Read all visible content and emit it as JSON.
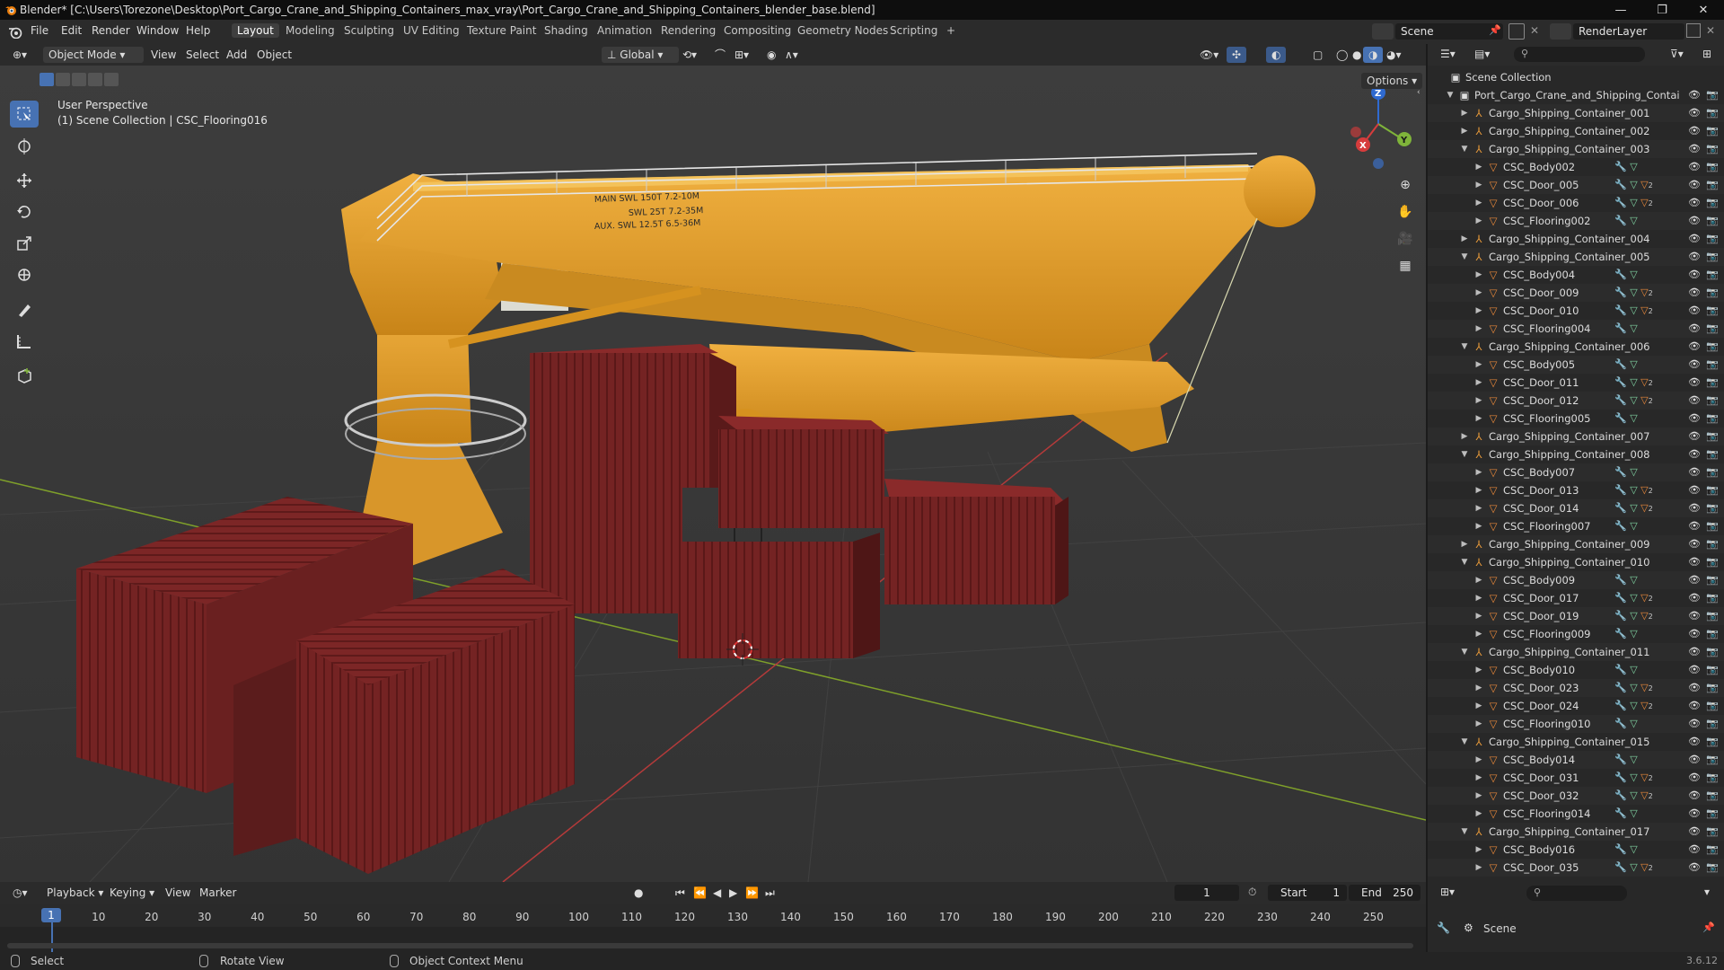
{
  "window": {
    "title": "Blender* [C:\\Users\\Torezone\\Desktop\\Port_Cargo_Crane_and_Shipping_Containers_max_vray\\Port_Cargo_Crane_and_Shipping_Containers_blender_base.blend]",
    "controls": [
      "—",
      "❐",
      "✕"
    ]
  },
  "menu": [
    "File",
    "Edit",
    "Render",
    "Window",
    "Help"
  ],
  "workspaces": [
    "Layout",
    "Modeling",
    "Sculpting",
    "UV Editing",
    "Texture Paint",
    "Shading",
    "Animation",
    "Rendering",
    "Compositing",
    "Geometry Nodes",
    "Scripting",
    "+"
  ],
  "active_workspace": "Layout",
  "scene_field": "Scene",
  "renderlayer_field": "RenderLayer",
  "viewport_header": {
    "mode": "Object Mode",
    "items": [
      "View",
      "Select",
      "Add",
      "Object"
    ],
    "orientation": "Global",
    "options": "Options"
  },
  "viewport": {
    "perspective": "User Perspective",
    "collection_info": "(1) Scene Collection | CSC_Flooring016",
    "crane_text": [
      "MAIN  SWL  150T 7.2-10M",
      "SWL  25T 7.2-35M",
      "AUX.  SWL 12.5T 6.5-36M"
    ],
    "gizmo": {
      "x": "X",
      "y": "Y",
      "z": "Z"
    }
  },
  "outliner": {
    "root": "Scene Collection",
    "rows": [
      {
        "label": "Port_Cargo_Crane_and_Shipping_Contai",
        "level": 1,
        "type": "collection",
        "expanded": true
      },
      {
        "label": "Cargo_Shipping_Container_001",
        "level": 2,
        "type": "empty",
        "expanded": false
      },
      {
        "label": "Cargo_Shipping_Container_002",
        "level": 2,
        "type": "empty",
        "expanded": false
      },
      {
        "label": "Cargo_Shipping_Container_003",
        "level": 2,
        "type": "empty",
        "expanded": true
      },
      {
        "label": "CSC_Body002",
        "level": 3,
        "type": "mesh",
        "mods": 1
      },
      {
        "label": "CSC_Door_005",
        "level": 3,
        "type": "mesh",
        "mods": 2
      },
      {
        "label": "CSC_Door_006",
        "level": 3,
        "type": "mesh",
        "mods": 2
      },
      {
        "label": "CSC_Flooring002",
        "level": 3,
        "type": "mesh",
        "mods": 1
      },
      {
        "label": "Cargo_Shipping_Container_004",
        "level": 2,
        "type": "empty",
        "expanded": false
      },
      {
        "label": "Cargo_Shipping_Container_005",
        "level": 2,
        "type": "empty",
        "expanded": true
      },
      {
        "label": "CSC_Body004",
        "level": 3,
        "type": "mesh",
        "mods": 1
      },
      {
        "label": "CSC_Door_009",
        "level": 3,
        "type": "mesh",
        "mods": 2
      },
      {
        "label": "CSC_Door_010",
        "level": 3,
        "type": "mesh",
        "mods": 2
      },
      {
        "label": "CSC_Flooring004",
        "level": 3,
        "type": "mesh",
        "mods": 1
      },
      {
        "label": "Cargo_Shipping_Container_006",
        "level": 2,
        "type": "empty",
        "expanded": true
      },
      {
        "label": "CSC_Body005",
        "level": 3,
        "type": "mesh",
        "mods": 1
      },
      {
        "label": "CSC_Door_011",
        "level": 3,
        "type": "mesh",
        "mods": 2
      },
      {
        "label": "CSC_Door_012",
        "level": 3,
        "type": "mesh",
        "mods": 2
      },
      {
        "label": "CSC_Flooring005",
        "level": 3,
        "type": "mesh",
        "mods": 1
      },
      {
        "label": "Cargo_Shipping_Container_007",
        "level": 2,
        "type": "empty",
        "expanded": false
      },
      {
        "label": "Cargo_Shipping_Container_008",
        "level": 2,
        "type": "empty",
        "expanded": true
      },
      {
        "label": "CSC_Body007",
        "level": 3,
        "type": "mesh",
        "mods": 1
      },
      {
        "label": "CSC_Door_013",
        "level": 3,
        "type": "mesh",
        "mods": 2
      },
      {
        "label": "CSC_Door_014",
        "level": 3,
        "type": "mesh",
        "mods": 2
      },
      {
        "label": "CSC_Flooring007",
        "level": 3,
        "type": "mesh",
        "mods": 1
      },
      {
        "label": "Cargo_Shipping_Container_009",
        "level": 2,
        "type": "empty",
        "expanded": false
      },
      {
        "label": "Cargo_Shipping_Container_010",
        "level": 2,
        "type": "empty",
        "expanded": true
      },
      {
        "label": "CSC_Body009",
        "level": 3,
        "type": "mesh",
        "mods": 1
      },
      {
        "label": "CSC_Door_017",
        "level": 3,
        "type": "mesh",
        "mods": 2
      },
      {
        "label": "CSC_Door_019",
        "level": 3,
        "type": "mesh",
        "mods": 2
      },
      {
        "label": "CSC_Flooring009",
        "level": 3,
        "type": "mesh",
        "mods": 1
      },
      {
        "label": "Cargo_Shipping_Container_011",
        "level": 2,
        "type": "empty",
        "expanded": true
      },
      {
        "label": "CSC_Body010",
        "level": 3,
        "type": "mesh",
        "mods": 1
      },
      {
        "label": "CSC_Door_023",
        "level": 3,
        "type": "mesh",
        "mods": 2
      },
      {
        "label": "CSC_Door_024",
        "level": 3,
        "type": "mesh",
        "mods": 2
      },
      {
        "label": "CSC_Flooring010",
        "level": 3,
        "type": "mesh",
        "mods": 1
      },
      {
        "label": "Cargo_Shipping_Container_015",
        "level": 2,
        "type": "empty",
        "expanded": true
      },
      {
        "label": "CSC_Body014",
        "level": 3,
        "type": "mesh",
        "mods": 1
      },
      {
        "label": "CSC_Door_031",
        "level": 3,
        "type": "mesh",
        "mods": 2
      },
      {
        "label": "CSC_Door_032",
        "level": 3,
        "type": "mesh",
        "mods": 2
      },
      {
        "label": "CSC_Flooring014",
        "level": 3,
        "type": "mesh",
        "mods": 1
      },
      {
        "label": "Cargo_Shipping_Container_017",
        "level": 2,
        "type": "empty",
        "expanded": true
      },
      {
        "label": "CSC_Body016",
        "level": 3,
        "type": "mesh",
        "mods": 1
      },
      {
        "label": "CSC_Door_035",
        "level": 3,
        "type": "mesh",
        "mods": 2
      }
    ]
  },
  "timeline": {
    "menus": [
      "Playback",
      "Keying",
      "View",
      "Marker"
    ],
    "current_frame": "1",
    "start_label": "Start",
    "start": "1",
    "end_label": "End",
    "end": "250",
    "ticks": [
      "10",
      "20",
      "30",
      "40",
      "50",
      "60",
      "70",
      "80",
      "90",
      "100",
      "110",
      "120",
      "130",
      "140",
      "150",
      "160",
      "170",
      "180",
      "190",
      "200",
      "210",
      "220",
      "230",
      "240",
      "250"
    ],
    "playhead": "1"
  },
  "properties": {
    "scene": "Scene"
  },
  "statusbar": {
    "select": "Select",
    "rotate": "Rotate View",
    "context": "Object Context Menu",
    "version": "3.6.12"
  },
  "colors": {
    "accent": "#4772b3",
    "crane": "#e8a22a",
    "container": "#7a2222",
    "grid_x": "#b43a3a",
    "grid_y": "#7fa02a"
  }
}
